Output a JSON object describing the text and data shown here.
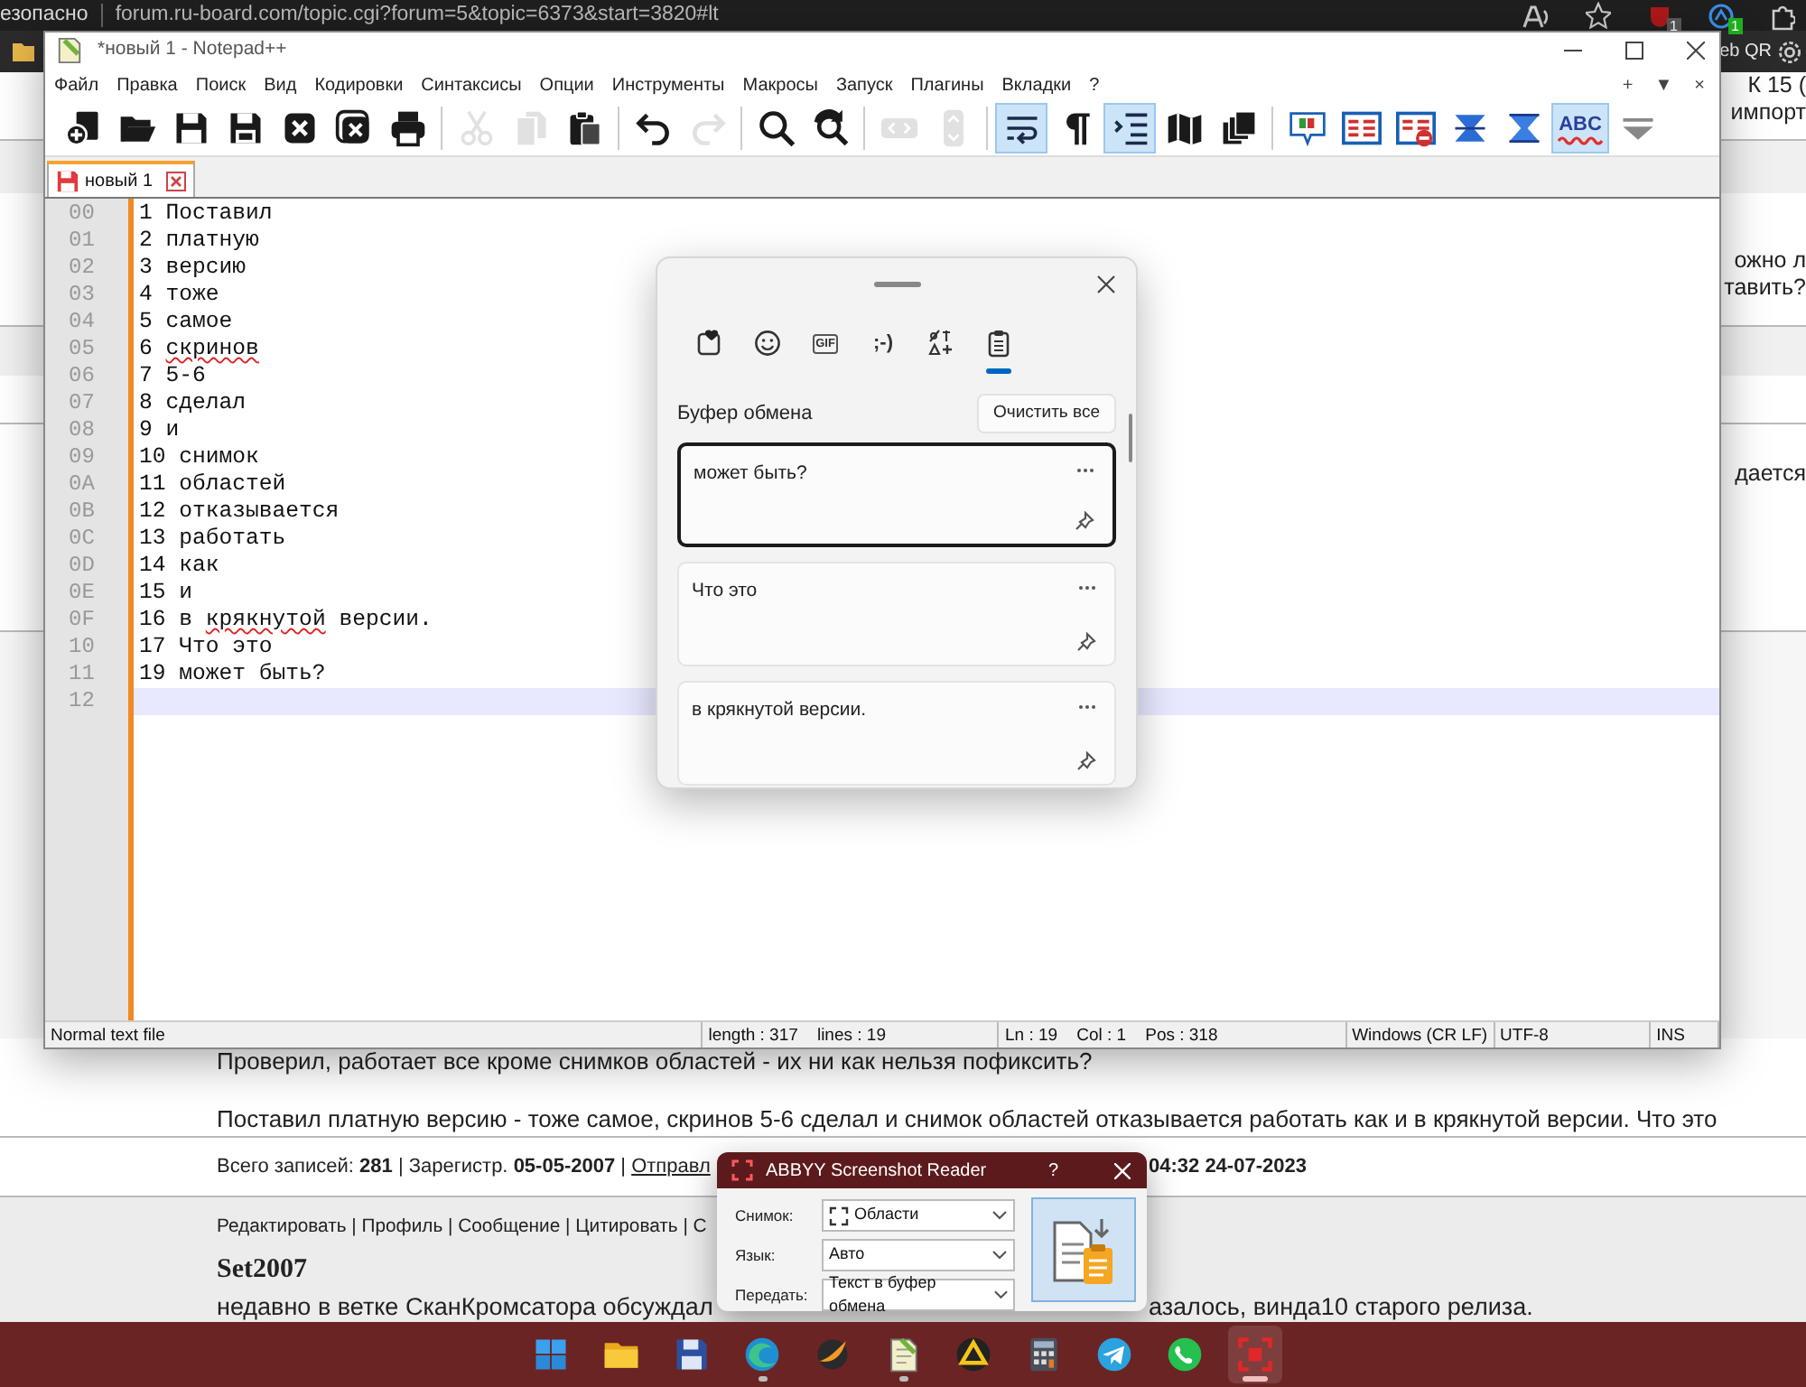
{
  "browser": {
    "security_text": "езопасно",
    "url": "forum.ru-board.com/topic.cgi?forum=5&topic=6373&start=3820#lt",
    "extension_badges": [
      {
        "text": "1",
        "color": "#5a5a5a"
      },
      {
        "text": "1",
        "color": "#1db31d"
      }
    ],
    "bookmark": "eb QR"
  },
  "forum": {
    "edge_fragments": [
      [
        "К 15 (",
        "импорт"
      ],
      [
        "ожно л",
        "тавить?"
      ],
      [
        "дается"
      ]
    ],
    "post_lines": [
      "Проверил, работает все кроме снимков областей - их ни как нельзя пофиксить?",
      "Поставил платную версию - тоже самое, скринов 5-6 сделал и снимок областей отказывается работать как и в крякнутой версии. Что это"
    ],
    "stats": "Всего записей: **281** | Зарегистр. **05-05-2007** |",
    "stats_link": "Отправл",
    "stats_time": "04:32 24-07-2023",
    "actions": "Редактировать | Профиль | Сообщение | Цитировать | С",
    "next_author": "Set2007",
    "next_text_left": "недавно в ветке СканКромсатора обсуждал",
    "next_text_right": "азалось, винда10 старого релиза."
  },
  "notepad": {
    "title": "*новый 1 - Notepad++",
    "menu": [
      "Файл",
      "Правка",
      "Поиск",
      "Вид",
      "Кодировки",
      "Синтаксисы",
      "Опции",
      "Инструменты",
      "Макросы",
      "Запуск",
      "Плагины",
      "Вкладки",
      "?"
    ],
    "menu_right": [
      "+",
      "▼",
      "×"
    ],
    "toolbar": [
      {
        "kind": "new",
        "disabled": false,
        "on": false
      },
      {
        "kind": "open",
        "disabled": false,
        "on": false
      },
      {
        "kind": "save",
        "disabled": false,
        "on": false
      },
      {
        "kind": "save-all",
        "disabled": false,
        "on": false
      },
      {
        "kind": "close",
        "disabled": false,
        "on": false
      },
      {
        "kind": "close-all",
        "disabled": false,
        "on": false
      },
      {
        "kind": "print",
        "disabled": false,
        "on": false
      },
      {
        "kind": "separator"
      },
      {
        "kind": "cut",
        "disabled": true,
        "on": false
      },
      {
        "kind": "copy",
        "disabled": true,
        "on": false
      },
      {
        "kind": "paste",
        "disabled": false,
        "on": false
      },
      {
        "kind": "separator"
      },
      {
        "kind": "undo",
        "disabled": false,
        "on": false
      },
      {
        "kind": "redo",
        "disabled": true,
        "on": false
      },
      {
        "kind": "separator"
      },
      {
        "kind": "find",
        "disabled": false,
        "on": false
      },
      {
        "kind": "replace",
        "disabled": false,
        "on": false
      },
      {
        "kind": "separator"
      },
      {
        "kind": "zoom",
        "disabled": true,
        "on": false
      },
      {
        "kind": "sync",
        "disabled": true,
        "on": false
      },
      {
        "kind": "separator"
      },
      {
        "kind": "wrap",
        "disabled": false,
        "on": true
      },
      {
        "kind": "paragraph",
        "disabled": false,
        "on": false
      },
      {
        "kind": "indent",
        "disabled": false,
        "on": true
      },
      {
        "kind": "map",
        "disabled": false,
        "on": false
      },
      {
        "kind": "docs",
        "disabled": false,
        "on": false
      },
      {
        "kind": "separator"
      },
      {
        "kind": "monitor",
        "disabled": false,
        "on": false
      },
      {
        "kind": "list",
        "disabled": false,
        "on": false
      },
      {
        "kind": "list-stop",
        "disabled": false,
        "on": false
      },
      {
        "kind": "fold",
        "disabled": false,
        "on": false
      },
      {
        "kind": "unfold",
        "disabled": false,
        "on": false
      },
      {
        "kind": "spell",
        "label": "ABC",
        "disabled": false,
        "on": true
      },
      {
        "kind": "more",
        "disabled": false,
        "on": false
      }
    ],
    "tabs": [
      {
        "label": "новый 1",
        "selected": true,
        "unsaved": true
      }
    ],
    "lines": [
      {
        "number": "00",
        "current": false,
        "segments": [
          {
            "text": "1 Поставил",
            "misspelled": false
          }
        ]
      },
      {
        "number": "01",
        "current": false,
        "segments": [
          {
            "text": "2 платную",
            "misspelled": false
          }
        ]
      },
      {
        "number": "02",
        "current": false,
        "segments": [
          {
            "text": "3 версию",
            "misspelled": false
          }
        ]
      },
      {
        "number": "03",
        "current": false,
        "segments": [
          {
            "text": "4 тоже",
            "misspelled": false
          }
        ]
      },
      {
        "number": "04",
        "current": false,
        "segments": [
          {
            "text": "5 самое",
            "misspelled": false
          }
        ]
      },
      {
        "number": "05",
        "current": false,
        "segments": [
          {
            "text": "6 ",
            "misspelled": false
          },
          {
            "text": "скринов",
            "misspelled": true
          }
        ]
      },
      {
        "number": "06",
        "current": false,
        "segments": [
          {
            "text": "7 5-6",
            "misspelled": false
          }
        ]
      },
      {
        "number": "07",
        "current": false,
        "segments": [
          {
            "text": "8 сделал",
            "misspelled": false
          }
        ]
      },
      {
        "number": "08",
        "current": false,
        "segments": [
          {
            "text": "9 и",
            "misspelled": false
          }
        ]
      },
      {
        "number": "09",
        "current": false,
        "segments": [
          {
            "text": "10 снимок",
            "misspelled": false
          }
        ]
      },
      {
        "number": "0A",
        "current": false,
        "segments": [
          {
            "text": "11 областей",
            "misspelled": false
          }
        ]
      },
      {
        "number": "0B",
        "current": false,
        "segments": [
          {
            "text": "12 отказывается",
            "misspelled": false
          }
        ]
      },
      {
        "number": "0C",
        "current": false,
        "segments": [
          {
            "text": "13 работать",
            "misspelled": false
          }
        ]
      },
      {
        "number": "0D",
        "current": false,
        "segments": [
          {
            "text": "14 как",
            "misspelled": false
          }
        ]
      },
      {
        "number": "0E",
        "current": false,
        "segments": [
          {
            "text": "15 и",
            "misspelled": false
          }
        ]
      },
      {
        "number": "0F",
        "current": false,
        "segments": [
          {
            "text": "16 в ",
            "misspelled": false
          },
          {
            "text": "крякнутой",
            "misspelled": true
          },
          {
            "text": " версии.",
            "misspelled": false
          }
        ]
      },
      {
        "number": "10",
        "current": false,
        "segments": [
          {
            "text": "17 Что это",
            "misspelled": false
          }
        ]
      },
      {
        "number": "11",
        "current": false,
        "segments": [
          {
            "text": "19 может быть?",
            "misspelled": false
          }
        ]
      },
      {
        "number": "12",
        "current": true
      }
    ],
    "status": [
      "Normal text file",
      "length : 317    lines : 19",
      "Ln : 19    Col : 1    Pos : 318",
      "Windows (CR LF)",
      "UTF-8",
      "INS"
    ]
  },
  "clipboard": {
    "tabs": [
      {
        "kind": "favorites",
        "selected": false
      },
      {
        "kind": "emoji",
        "selected": false
      },
      {
        "kind": "gif",
        "label": "GIF",
        "selected": false
      },
      {
        "kind": "kaomoji",
        "label": ";-)",
        "selected": false
      },
      {
        "kind": "symbols",
        "selected": false
      },
      {
        "kind": "clipboard",
        "selected": true
      }
    ],
    "title": "Буфер обмена",
    "clear_button": "Очистить все",
    "items": [
      {
        "text": "может быть?",
        "selected": true
      },
      {
        "text": "Что это",
        "selected": false
      },
      {
        "text": "в крякнутой версии.",
        "selected": false
      }
    ]
  },
  "abbyy": {
    "title": "ABBYY Screenshot Reader",
    "help": "?",
    "fields": [
      {
        "label": "Снимок:",
        "value": "Области",
        "kind": "region"
      },
      {
        "label": "Язык:",
        "value": "Авто",
        "kind": "plain"
      },
      {
        "label": "Передать:",
        "value": "Текст в буфер обмена",
        "kind": "plain"
      }
    ]
  },
  "taskbar": [
    {
      "kind": "start",
      "running": false,
      "active": false
    },
    {
      "kind": "folder",
      "running": false,
      "active": false
    },
    {
      "kind": "floppy",
      "running": false,
      "active": false
    },
    {
      "kind": "edge",
      "running": true,
      "active": false
    },
    {
      "kind": "swoosh",
      "running": false,
      "active": false
    },
    {
      "kind": "notepad",
      "running": true,
      "active": false
    },
    {
      "kind": "triangle",
      "running": false,
      "active": false
    },
    {
      "kind": "calculator",
      "running": false,
      "active": false
    },
    {
      "kind": "telegram",
      "running": false,
      "active": false
    },
    {
      "kind": "whatsapp",
      "running": false,
      "active": false
    },
    {
      "kind": "screenshot",
      "running": true,
      "active": true
    }
  ]
}
